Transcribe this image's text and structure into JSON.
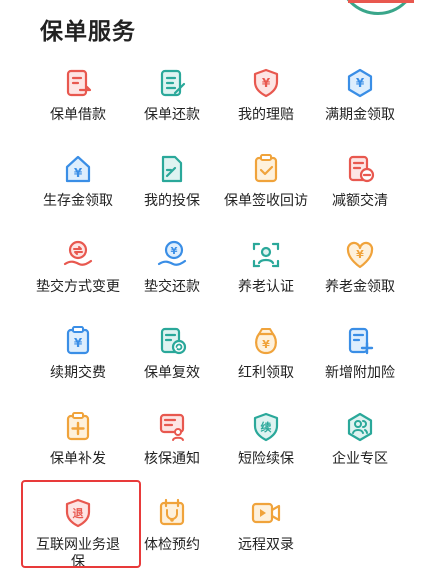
{
  "section": {
    "title": "保单服务"
  },
  "colors": {
    "red": "#e8584f",
    "teal": "#2aa89a",
    "orange": "#f0a33b",
    "blue": "#3a8ee6"
  },
  "services": [
    {
      "label": "保单借款",
      "icon": "document-money-icon"
    },
    {
      "label": "保单还款",
      "icon": "document-edit-icon"
    },
    {
      "label": "我的理赔",
      "icon": "yuan-shield-icon"
    },
    {
      "label": "满期金领取",
      "icon": "yuan-hexagon-icon"
    },
    {
      "label": "生存金领取",
      "icon": "yuan-house-icon"
    },
    {
      "label": "我的投保",
      "icon": "document-pen-icon"
    },
    {
      "label": "保单签收回访",
      "icon": "clipboard-check-icon"
    },
    {
      "label": "减额交清",
      "icon": "document-minus-icon"
    },
    {
      "label": "垫交方式变更",
      "icon": "hand-exchange-icon"
    },
    {
      "label": "垫交还款",
      "icon": "hand-yuan-icon"
    },
    {
      "label": "养老认证",
      "icon": "face-scan-icon"
    },
    {
      "label": "养老金领取",
      "icon": "yuan-heart-icon"
    },
    {
      "label": "续期交费",
      "icon": "clipboard-yuan-icon"
    },
    {
      "label": "保单复效",
      "icon": "document-refresh-icon"
    },
    {
      "label": "红利领取",
      "icon": "yuan-bag-icon"
    },
    {
      "label": "新增附加险",
      "icon": "document-plus-icon"
    },
    {
      "label": "保单补发",
      "icon": "clipboard-plus-icon"
    },
    {
      "label": "核保通知",
      "icon": "mail-user-icon"
    },
    {
      "label": "短险续保",
      "icon": "shield-renew-icon"
    },
    {
      "label": "企业专区",
      "icon": "enterprise-users-icon"
    },
    {
      "label": "互联网业务退\n保",
      "icon": "shield-refund-icon"
    },
    {
      "label": "体检预约",
      "icon": "calendar-stethoscope-icon"
    },
    {
      "label": "远程双录",
      "icon": "video-record-icon"
    }
  ],
  "icon_text": {
    "yuan": "¥",
    "refund": "退",
    "renew": "续"
  }
}
